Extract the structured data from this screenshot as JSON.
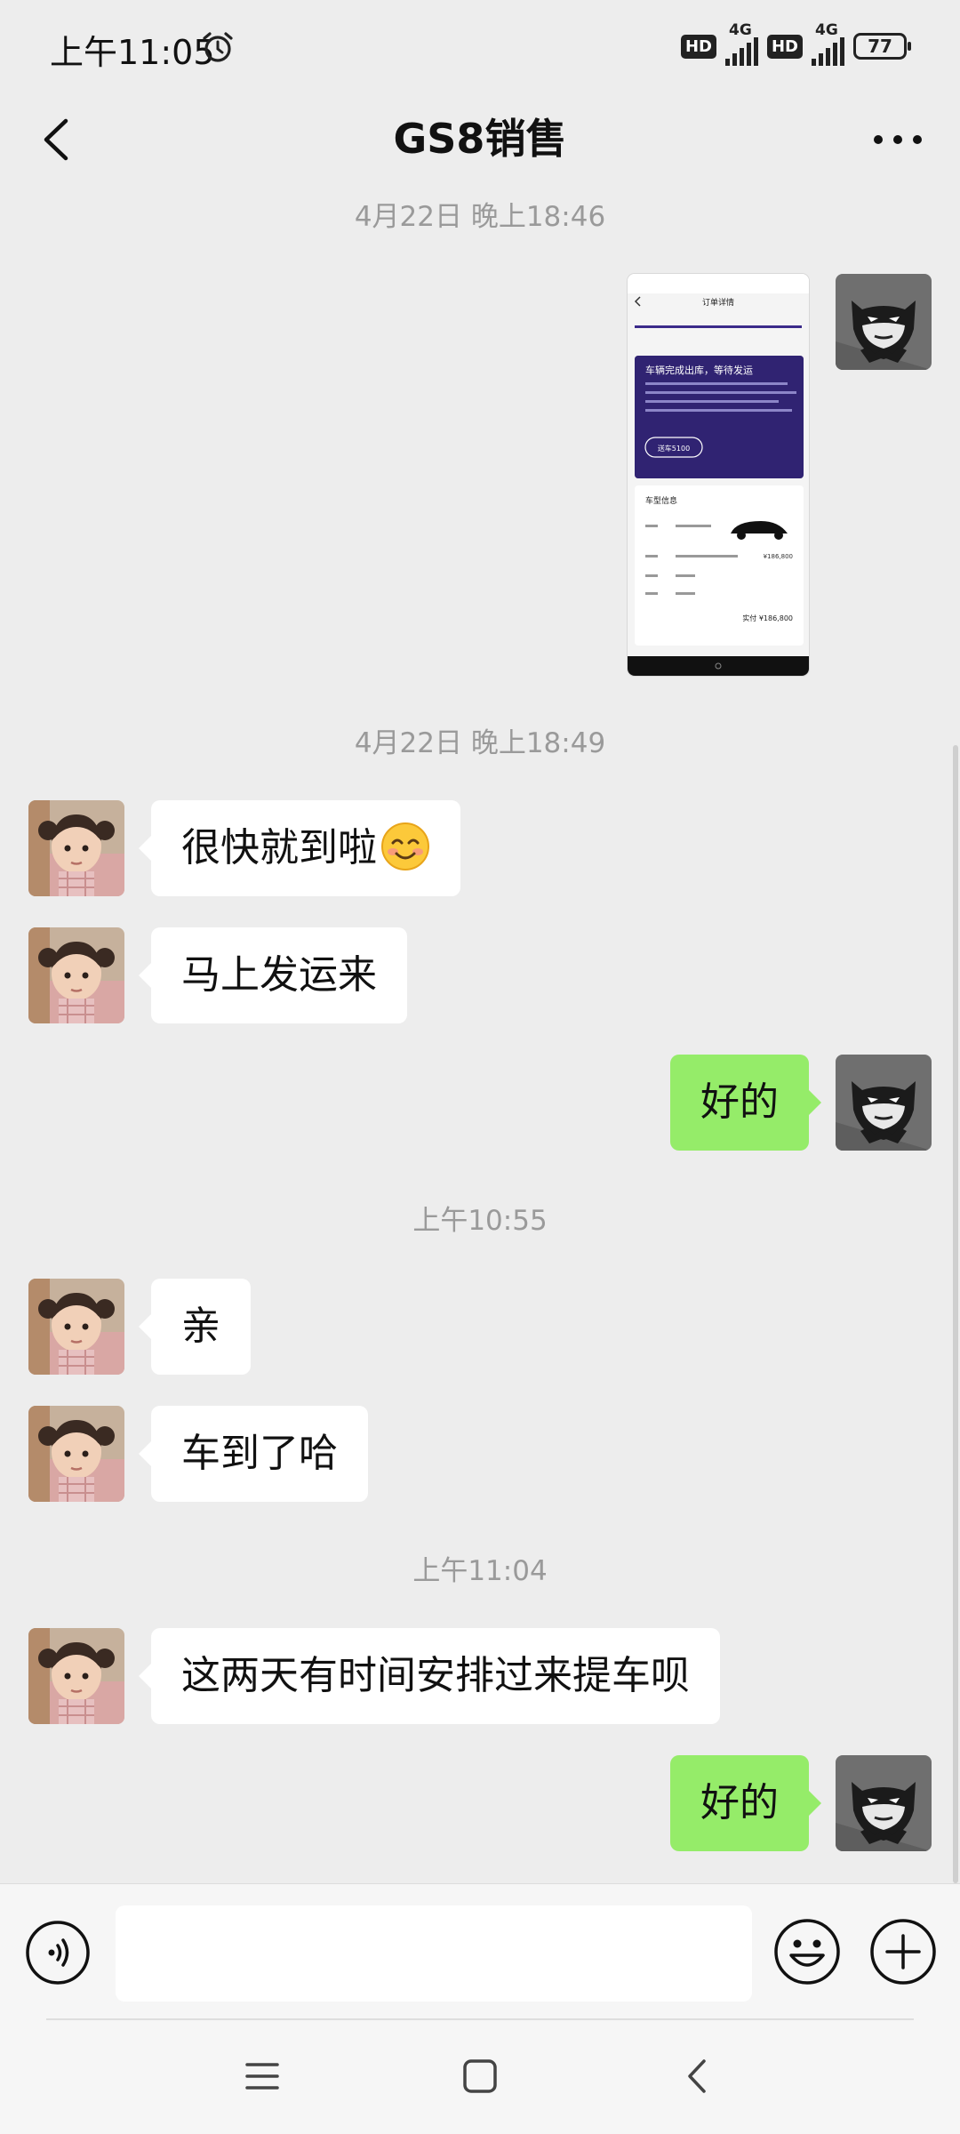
{
  "status_bar": {
    "time": "上午11:05",
    "hd_badge": "HD",
    "network_left": "4G",
    "network_right": "4G",
    "battery": "77"
  },
  "header": {
    "title": "GS8销售"
  },
  "messages": {
    "ts1": "4月22日 晚上18:46",
    "ts2": "4月22日 晚上18:49",
    "m1": "很快就到啦",
    "m2": "马上发运来",
    "m3": "好的",
    "ts3": "上午10:55",
    "m4": "亲",
    "m5": "车到了哈",
    "ts4": "上午11:04",
    "m6": "这两天有时间安排过来提车呗",
    "m7": "好的"
  },
  "shared_screenshot": {
    "page_title": "订单详情",
    "banner_title": "车辆完成出库，等待发运",
    "banner_button": "送车5100",
    "section_title": "车型信息",
    "price_label": "¥186,800",
    "total_label": "实付 ¥186,800"
  },
  "colors": {
    "background": "#ededed",
    "incoming_bubble": "#ffffff",
    "outgoing_bubble": "#95ec69",
    "timestamp": "#9a9a9a"
  }
}
